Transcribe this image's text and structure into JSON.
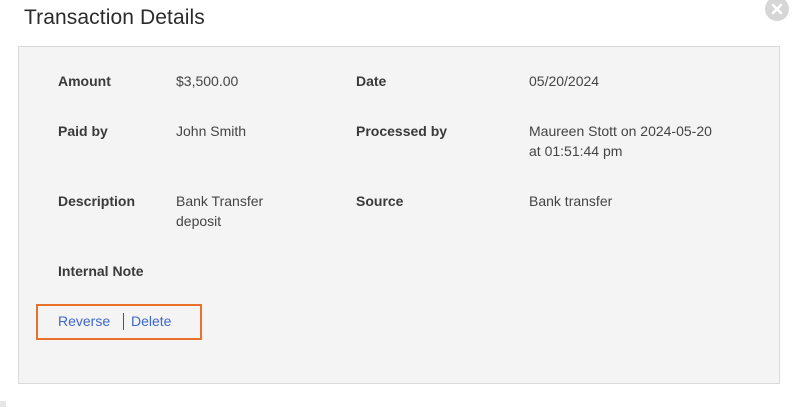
{
  "modal": {
    "title": "Transaction Details",
    "close_icon": "close-icon"
  },
  "details": {
    "amount_label": "Amount",
    "amount_value": "$3,500.00",
    "date_label": "Date",
    "date_value": "05/20/2024",
    "paid_by_label": "Paid by",
    "paid_by_value": "John Smith",
    "processed_by_label": "Processed by",
    "processed_by_line1": "Maureen Stott on 2024-05-20",
    "processed_by_line2": "at 01:51:44 pm",
    "description_label": "Description",
    "description_line1": "Bank Transfer",
    "description_line2": "deposit",
    "source_label": "Source",
    "source_value": "Bank transfer",
    "internal_note_label": "Internal Note"
  },
  "actions": {
    "reverse_label": "Reverse",
    "delete_label": "Delete"
  },
  "colors": {
    "link": "#3d67c4",
    "highlight_border": "#e8722b",
    "panel_bg": "#f4f4f4"
  }
}
